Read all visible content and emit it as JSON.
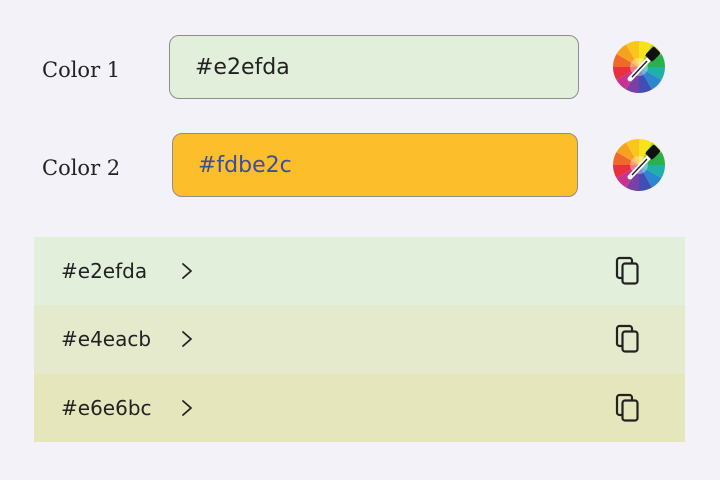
{
  "colors": {
    "color1": {
      "label": "Color 1",
      "value": "#e2efda",
      "background": "#e2efda",
      "picker_icon": "color-wheel-eyedropper-icon"
    },
    "color2": {
      "label": "Color 2",
      "value": "#fdbe2c",
      "background": "#fdbe2c",
      "picker_icon": "color-wheel-eyedropper-icon"
    }
  },
  "palette": {
    "items": [
      {
        "hex": "#e2efda",
        "background": "#e2efda",
        "chevron_icon": "chevron-right-icon",
        "copy_icon": "copy-icon"
      },
      {
        "hex": "#e4eacb",
        "background": "#e4eacb",
        "chevron_icon": "chevron-right-icon",
        "copy_icon": "copy-icon"
      },
      {
        "hex": "#e6e6bc",
        "background": "#e6e6bc",
        "chevron_icon": "chevron-right-icon",
        "copy_icon": "copy-icon"
      }
    ]
  }
}
